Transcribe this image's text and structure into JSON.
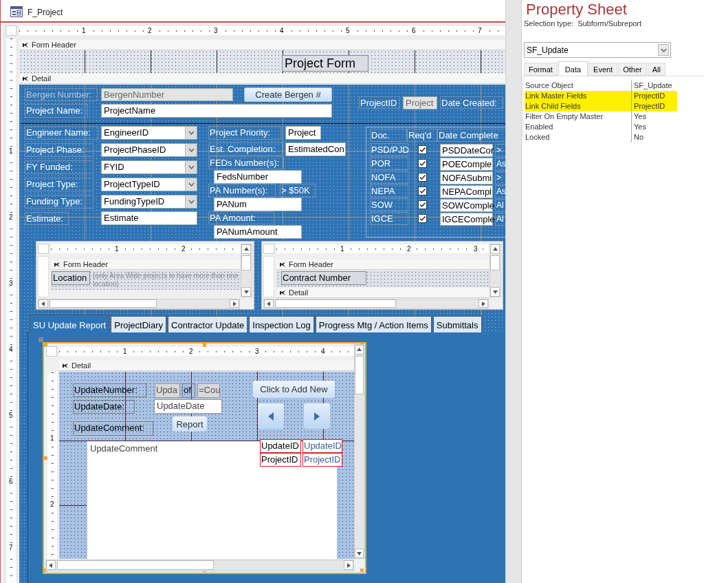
{
  "window": {
    "title": "F_Project"
  },
  "ruler": {
    "horizontal": [
      "1",
      "2",
      "3",
      "4",
      "5",
      "6",
      "7"
    ],
    "vertical": [
      "1",
      "2",
      "3",
      "4",
      "5",
      "6",
      "7"
    ]
  },
  "sections": [
    {
      "label": "Form Header"
    },
    {
      "label": "Detail"
    }
  ],
  "form_header": {
    "title": "Project Form"
  },
  "controls": [
    {
      "kind": "label",
      "text": "Bergen Number:",
      "disabled": true
    },
    {
      "kind": "textbox",
      "text": "BergenNumber",
      "disabled": true
    },
    {
      "kind": "button",
      "text": "Create Bergen #",
      "disabled": false
    },
    {
      "kind": "label",
      "text": "Project Name:",
      "disabled": false
    },
    {
      "kind": "textbox",
      "text": "ProjectName",
      "disabled": false
    },
    {
      "kind": "label",
      "text": "ProjectID",
      "disabled": false
    },
    {
      "kind": "textbox",
      "text": "Project",
      "disabled": true
    },
    {
      "kind": "label",
      "text": "Date Created:",
      "disabled": false
    },
    {
      "kind": "label",
      "text": "Engineer Name:",
      "disabled": false
    },
    {
      "kind": "combo",
      "text": "EngineerID",
      "disabled": false
    },
    {
      "kind": "label",
      "text": "Project Phase:",
      "disabled": false
    },
    {
      "kind": "combo",
      "text": "ProjectPhaseID",
      "disabled": false
    },
    {
      "kind": "label",
      "text": "FY Funded:",
      "disabled": false
    },
    {
      "kind": "combo",
      "text": "FYID",
      "disabled": false
    },
    {
      "kind": "label",
      "text": "Project Type:",
      "disabled": false
    },
    {
      "kind": "combo",
      "text": "ProjectTypeID",
      "disabled": false
    },
    {
      "kind": "label",
      "text": "Funding Type:",
      "disabled": false
    },
    {
      "kind": "combo",
      "text": "FundingTypeID",
      "disabled": false
    },
    {
      "kind": "label",
      "text": "Estimate:",
      "disabled": false
    },
    {
      "kind": "textbox",
      "text": "Estimate",
      "disabled": false
    },
    {
      "kind": "label",
      "text": "Project Priority:",
      "disabled": false
    },
    {
      "kind": "textbox",
      "text": "Project",
      "disabled": false
    },
    {
      "kind": "label",
      "text": "Est. Completion:",
      "disabled": false
    },
    {
      "kind": "textbox",
      "text": "EstimatedCon",
      "disabled": false
    },
    {
      "kind": "label",
      "text": "FEDs Number(s):",
      "disabled": false
    },
    {
      "kind": "textbox",
      "text": "FedsNumber",
      "disabled": false
    },
    {
      "kind": "label",
      "text": "PA Number(s):",
      "disabled": false
    },
    {
      "kind": "label",
      "text": "> $50K",
      "disabled": false
    },
    {
      "kind": "textbox",
      "text": "PANum",
      "disabled": false
    },
    {
      "kind": "label",
      "text": "PA Amount:",
      "disabled": false
    },
    {
      "kind": "textbox",
      "text": "PANumAmount",
      "disabled": false
    }
  ],
  "doc_table": {
    "headers": [
      "Doc.",
      "Req'd",
      "Date Complete"
    ],
    "rows": [
      {
        "doc": "PSD/PJD",
        "required": true,
        "date_field": "PSDDateCor",
        "column_4": ">"
      },
      {
        "doc": "POR",
        "required": true,
        "date_field": "POEComple",
        "column_4": "As"
      },
      {
        "doc": "NOFA",
        "required": true,
        "date_field": "NOFASubmi",
        "column_4": ">"
      },
      {
        "doc": "NEPA",
        "required": true,
        "date_field": "NEPACompl",
        "column_4": "As"
      },
      {
        "doc": "SOW",
        "required": true,
        "date_field": "SOWComple",
        "column_4": "Al"
      },
      {
        "doc": "IGCE",
        "required": true,
        "date_field": "IGCEComple",
        "column_4": "Al"
      }
    ]
  },
  "subforms": [
    {
      "ruler": [
        "1",
        "2"
      ],
      "section": "Form Header",
      "items": [
        {
          "kind": "label",
          "text": "Location"
        },
        {
          "kind": "note",
          "text": "(only Area Wide projects to have more than one location)"
        }
      ]
    },
    {
      "ruler": [
        "1",
        "2",
        "3"
      ],
      "section": "Form Header",
      "items": [
        {
          "kind": "label",
          "text": "Contract Number"
        }
      ],
      "detail": "Detail"
    }
  ],
  "tabs": [
    {
      "label": "SU Update Report",
      "selected": true
    },
    {
      "label": "ProjectDiary",
      "selected": false
    },
    {
      "label": "Contractor Update",
      "selected": false
    },
    {
      "label": "Inspection Log",
      "selected": false
    },
    {
      "label": "Progress Mtg / Action Items",
      "selected": false
    },
    {
      "label": "Submittals",
      "selected": false
    }
  ],
  "update_subform": {
    "ruler": [
      "1",
      "2",
      "3",
      "4"
    ],
    "vertical_ruler": [
      "1",
      "2"
    ],
    "section": "Detail",
    "controls": [
      {
        "kind": "label",
        "text": "UpdateNumber:"
      },
      {
        "kind": "locked_textbox",
        "text": "Upda"
      },
      {
        "kind": "label",
        "text": "of"
      },
      {
        "kind": "locked_textbox",
        "text": "=Cou"
      },
      {
        "kind": "label",
        "text": "UpdateDate:"
      },
      {
        "kind": "textbox",
        "text": "UpdateDate"
      },
      {
        "kind": "label",
        "text": "UpdateComment:"
      },
      {
        "kind": "button",
        "text": "Report"
      },
      {
        "kind": "button",
        "text": "Click to Add New"
      },
      {
        "kind": "nav_previous"
      },
      {
        "kind": "nav_next"
      },
      {
        "kind": "memo",
        "text": "UpdateComment"
      },
      {
        "kind": "marked_label",
        "text": "UpdateID"
      },
      {
        "kind": "marked_textbox",
        "text": "UpdateID"
      },
      {
        "kind": "marked_label",
        "text": "ProjectID"
      },
      {
        "kind": "marked_textbox",
        "text": "ProjectID"
      }
    ]
  },
  "property_sheet": {
    "title": "Property Sheet",
    "selection_type_label": "Selection type:",
    "selection_type": "Subform/Subreport",
    "object": "SF_Update",
    "tabs": [
      {
        "label": "Format",
        "selected": false
      },
      {
        "label": "Data",
        "selected": true
      },
      {
        "label": "Event",
        "selected": false
      },
      {
        "label": "Other",
        "selected": false
      },
      {
        "label": "All",
        "selected": false
      }
    ],
    "properties": [
      {
        "name": "Source Object",
        "value": "SF_Update",
        "highlighted": false
      },
      {
        "name": "Link Master Fields",
        "value": "ProjectID",
        "highlighted": true
      },
      {
        "name": "Link Child Fields",
        "value": "ProjectID",
        "highlighted": true
      },
      {
        "name": "Filter On Empty Master",
        "value": "Yes",
        "highlighted": false
      },
      {
        "name": "Enabled",
        "value": "Yes",
        "highlighted": false
      },
      {
        "name": "Locked",
        "value": "No",
        "highlighted": false
      }
    ]
  }
}
